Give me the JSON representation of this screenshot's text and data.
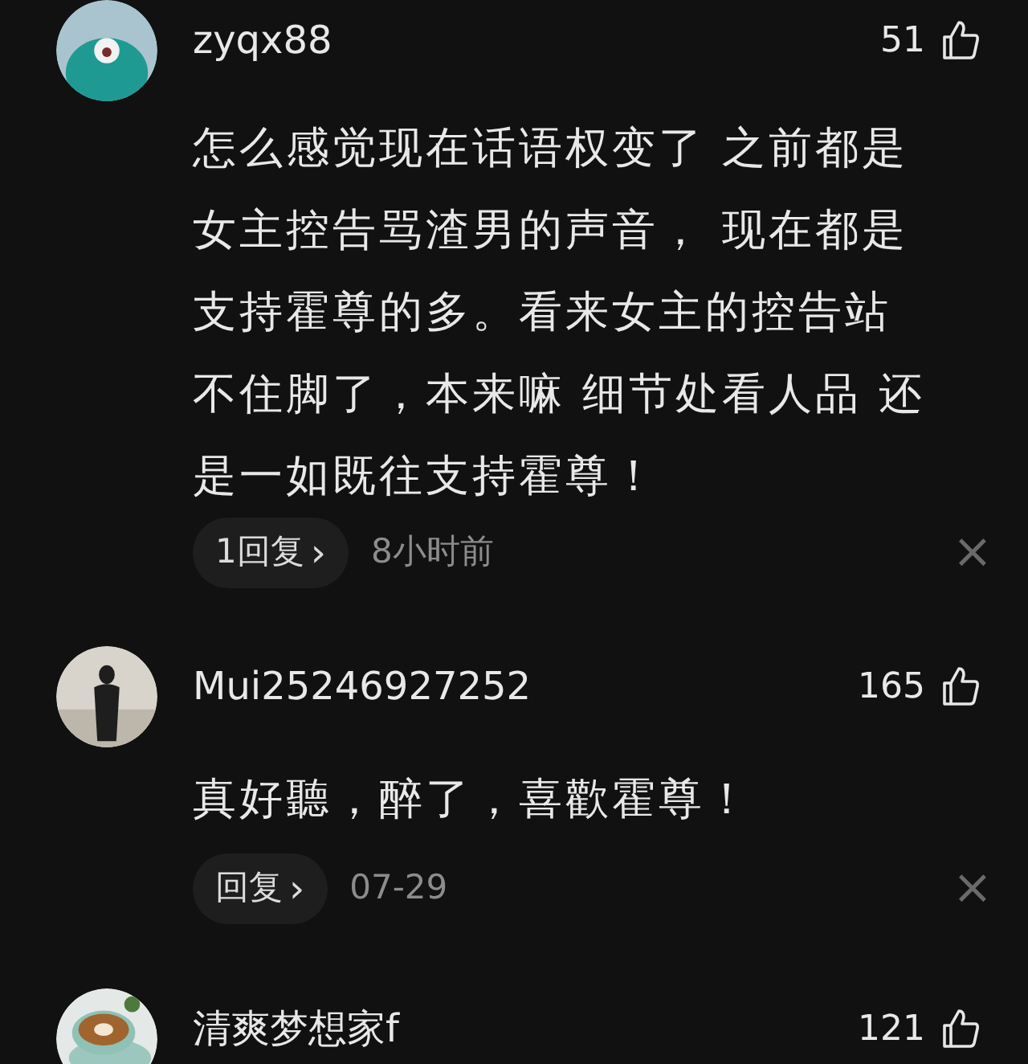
{
  "comments": [
    {
      "username": "zyqx88",
      "likes": "51",
      "text_lines": [
        "怎么感觉现在话语权变了 之前都是",
        "女主控告骂渣男的声音， 现在都是",
        "支持霍尊的多。看来女主的控告站",
        "不住脚了，本来嘛 细节处看人品 还",
        "是一如既往支持霍尊！"
      ],
      "reply_button": "1回复",
      "chevron": "›",
      "time": "8小时前",
      "close": "×"
    },
    {
      "username": "Mui25246927252",
      "likes": "165",
      "text_lines": [
        "真好聽，醉了，喜歡霍尊！"
      ],
      "reply_button": "回复",
      "chevron": "›",
      "time": "07-29",
      "close": "×"
    },
    {
      "username": "清爽梦想家f",
      "likes": "121"
    }
  ]
}
